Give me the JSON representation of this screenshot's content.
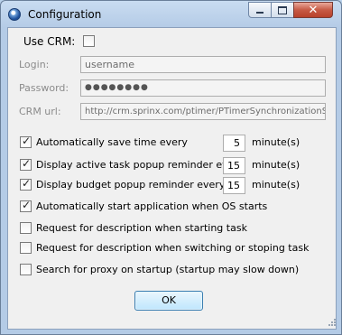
{
  "window": {
    "title": "Configuration"
  },
  "crm": {
    "use_crm_label": "Use CRM:",
    "use_crm_checked": false,
    "login_label": "Login:",
    "login_value": "username",
    "password_label": "Password:",
    "password_value": "●●●●●●●●",
    "url_label": "CRM url:",
    "url_value": "http://crm.sprinx.com/ptimer/PTimerSynchronizationSe"
  },
  "options": [
    {
      "label": "Automatically save time every",
      "checked": true,
      "value": "5",
      "unit": "minute(s)"
    },
    {
      "label": "Display active task popup reminder every",
      "checked": true,
      "value": "15",
      "unit": "minute(s)"
    },
    {
      "label": "Display budget popup reminder every",
      "checked": true,
      "value": "15",
      "unit": "minute(s)"
    },
    {
      "label": "Automatically start application when OS starts",
      "checked": true
    },
    {
      "label": "Request for description when starting task",
      "checked": false
    },
    {
      "label": "Request for description when switching or stoping task",
      "checked": false
    },
    {
      "label": "Search for proxy on startup (startup may slow down)",
      "checked": false
    }
  ],
  "ok_label": "OK",
  "close_glyph": "✕"
}
